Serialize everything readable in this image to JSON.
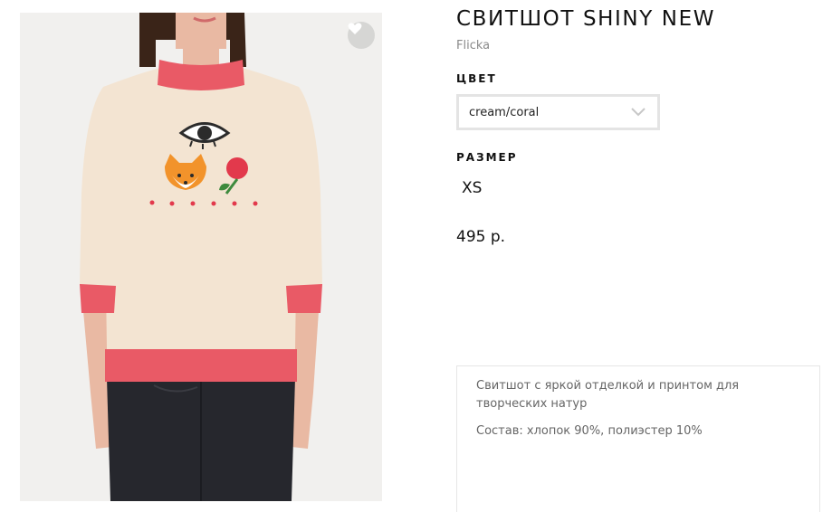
{
  "product": {
    "title": "СВИТШОТ SHINY NEW",
    "brand": "Flicka",
    "price": "495 р."
  },
  "color": {
    "label": "ЦВЕТ",
    "selected": "cream/coral"
  },
  "size": {
    "label": "РАЗМЕР",
    "options": [
      "XS"
    ]
  },
  "description": {
    "text": "Свитшот с яркой отделкой и принтом для творческих натур",
    "composition": "Состав: хлопок 90%, полиэстер 10%"
  },
  "icons": {
    "favorite": "heart-icon",
    "dropdown": "chevron-down-icon"
  },
  "colors": {
    "sweatshirt": "#f3e4d2",
    "trim": "#e95a66",
    "jeans": "#26272d",
    "skin": "#e9b9a3",
    "hair": "#3a2418"
  }
}
